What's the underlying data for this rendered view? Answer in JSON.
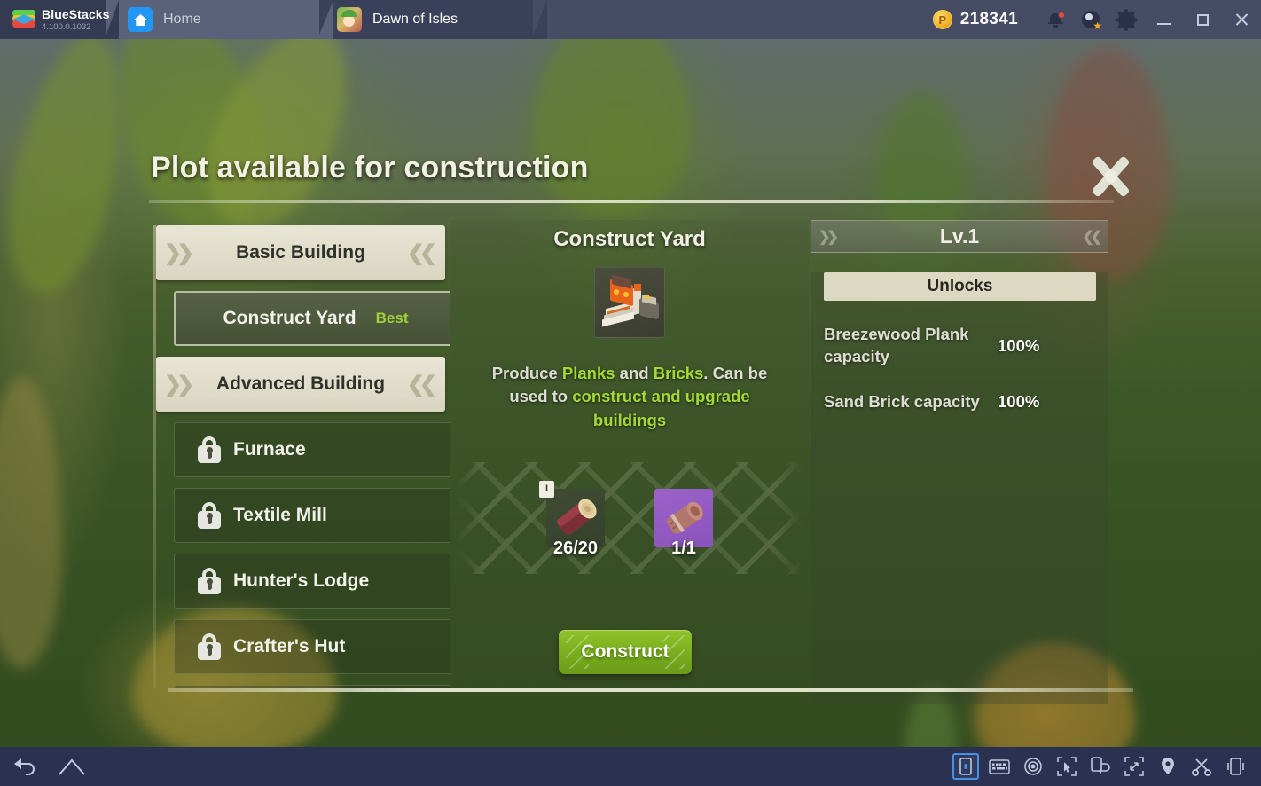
{
  "titlebar": {
    "brand_name": "BlueStacks",
    "version": "4.100.0.1032",
    "logo_icon": "bluestacks-logo-icon",
    "tabs": [
      {
        "label": "Home",
        "icon": "home-icon",
        "active": false
      },
      {
        "label": "Dawn of Isles",
        "icon": "game-avatar-icon",
        "active": true
      }
    ],
    "points": "218341",
    "points_icon": "points-coin-icon",
    "notifications_icon": "bell-icon",
    "macro_icon": "macro-star-icon",
    "settings_icon": "gear-icon",
    "minimize_icon": "minimize-icon",
    "maximize_icon": "maximize-icon",
    "close_icon": "close-icon"
  },
  "modal": {
    "title": "Plot available for construction",
    "close_icon": "close-x-icon"
  },
  "sidebar": {
    "categories": [
      {
        "label": "Basic Building",
        "type": "category"
      },
      {
        "label": "Advanced Building",
        "type": "category"
      }
    ],
    "items": [
      {
        "label": "Construct Yard",
        "badge": "Best",
        "locked": false,
        "selected": true
      },
      {
        "label": "Furnace",
        "badge": "",
        "locked": true,
        "selected": false
      },
      {
        "label": "Textile Mill",
        "badge": "",
        "locked": true,
        "selected": false
      },
      {
        "label": "Hunter's Lodge",
        "badge": "",
        "locked": true,
        "selected": false
      },
      {
        "label": "Crafter's Hut",
        "badge": "",
        "locked": true,
        "selected": false
      }
    ],
    "lock_icon": "lock-icon"
  },
  "detail": {
    "title": "Construct Yard",
    "building_icon": "construct-yard-building-icon",
    "description_parts": [
      {
        "text": "Produce ",
        "highlight": false
      },
      {
        "text": "Planks",
        "highlight": true
      },
      {
        "text": " and ",
        "highlight": false
      },
      {
        "text": "Bricks",
        "highlight": true
      },
      {
        "text": ". Can be used to ",
        "highlight": false
      },
      {
        "text": "construct and upgrade buildings",
        "highlight": true
      }
    ],
    "costs": [
      {
        "name": "breezewood-log",
        "quantity": "26/20",
        "grade_badge": "I",
        "icon": "wood-log-icon"
      },
      {
        "name": "sand-brick",
        "quantity": "1/1",
        "grade_badge": "",
        "icon": "brick-roll-icon"
      }
    ],
    "construct_label": "Construct"
  },
  "upgrade_panel": {
    "level": "Lv.1",
    "unlocks_header": "Unlocks",
    "unlocks": [
      {
        "name": "Breezewood Plank capacity",
        "value": "100%"
      },
      {
        "name": "Sand Brick capacity",
        "value": "100%"
      }
    ]
  },
  "bottombar": {
    "left_icons": [
      "back-icon",
      "home-icon"
    ],
    "right_icons": [
      "lock-orientation-icon",
      "keyboard-icon",
      "eye-icon",
      "pointer-select-icon",
      "rotate-screen-icon",
      "fullscreen-icon",
      "location-pin-icon",
      "scissors-icon",
      "shake-device-icon"
    ]
  },
  "colors": {
    "accent_green": "#9fd23a",
    "button_green": "#79ad1e",
    "panel_cream": "#ddd8c2",
    "titlebar_bg": "#454c63",
    "bottombar_bg": "#2b3150"
  }
}
